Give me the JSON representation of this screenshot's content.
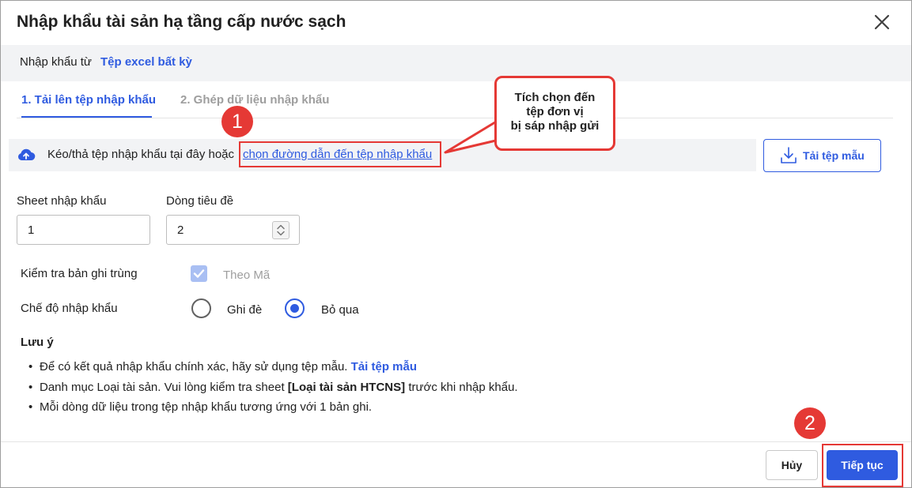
{
  "dialog": {
    "title": "Nhập khẩu tài sản hạ tầng cấp nước sạch",
    "close_icon": "close-icon"
  },
  "source": {
    "label": "Nhập khẩu từ",
    "value": "Tệp excel bất kỳ"
  },
  "tabs": [
    {
      "label": "1. Tải lên tệp nhập khẩu",
      "active": true
    },
    {
      "label": "2. Ghép dữ liệu nhập khẩu",
      "active": false
    }
  ],
  "upload": {
    "icon": "cloud-upload-icon",
    "text": "Kéo/thả tệp nhập khẩu tại đây hoặc",
    "link": "chọn đường dẫn đến tệp nhập khẩu"
  },
  "template_button": {
    "icon": "download-icon",
    "label": "Tải tệp mẫu"
  },
  "callout": {
    "lines": [
      "Tích chọn đến",
      "tệp đơn vị",
      "bị sáp nhập gửi"
    ]
  },
  "badges": {
    "one": "1",
    "two": "2"
  },
  "fields": {
    "sheet": {
      "label": "Sheet nhập khẩu",
      "value": "1"
    },
    "header_row": {
      "label": "Dòng tiêu đề",
      "value": "2"
    }
  },
  "duplicate_check": {
    "label": "Kiểm tra bản ghi trùng",
    "option": "Theo Mã",
    "checked": true,
    "disabled": true
  },
  "import_mode": {
    "label": "Chế độ nhập khẩu",
    "options": [
      {
        "label": "Ghi đè",
        "selected": false
      },
      {
        "label": "Bỏ qua",
        "selected": true
      }
    ]
  },
  "notes": {
    "title": "Lưu ý",
    "note1_text": "Để có kết quả nhập khẩu chính xác, hãy sử dụng tệp mẫu.",
    "note1_link": "Tải tệp mẫu",
    "note2_pre": "Danh mục Loại tài sản. Vui lòng kiểm tra sheet",
    "note2_bold": "[Loại tài sản HTCNS]",
    "note2_post": "trước khi nhập khẩu.",
    "note3": "Mỗi dòng dữ liệu trong tệp nhập khẩu tương ứng với 1 bản ghi."
  },
  "footer": {
    "cancel_label": "Hủy",
    "continue_label": "Tiếp tục"
  },
  "colors": {
    "accent": "#2f5be0",
    "annotation": "#e53935",
    "panel_bg": "#f2f3f5"
  }
}
